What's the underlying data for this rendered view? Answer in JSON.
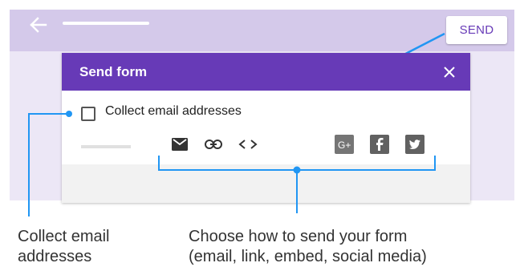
{
  "toolbar": {
    "back_icon": "arrow-left-icon",
    "send_label": "SEND"
  },
  "dialog": {
    "title": "Send form",
    "close_icon": "close-icon",
    "collect_email_label": "Collect email addresses",
    "send_via_icons": [
      "email-icon",
      "link-icon",
      "embed-code-icon"
    ],
    "social_icons": [
      "google-plus-icon",
      "facebook-icon",
      "twitter-icon"
    ]
  },
  "captions": {
    "collect_email_line1": "Collect email",
    "collect_email_line2": "addresses",
    "send_methods_line1": "Choose how to send your form",
    "send_methods_line2": "(email, link, embed, social media)"
  },
  "colors": {
    "accent": "#673ab7",
    "callout": "#2196f3",
    "header_background": "#d4c9ea",
    "page_background": "#ece7f6"
  }
}
